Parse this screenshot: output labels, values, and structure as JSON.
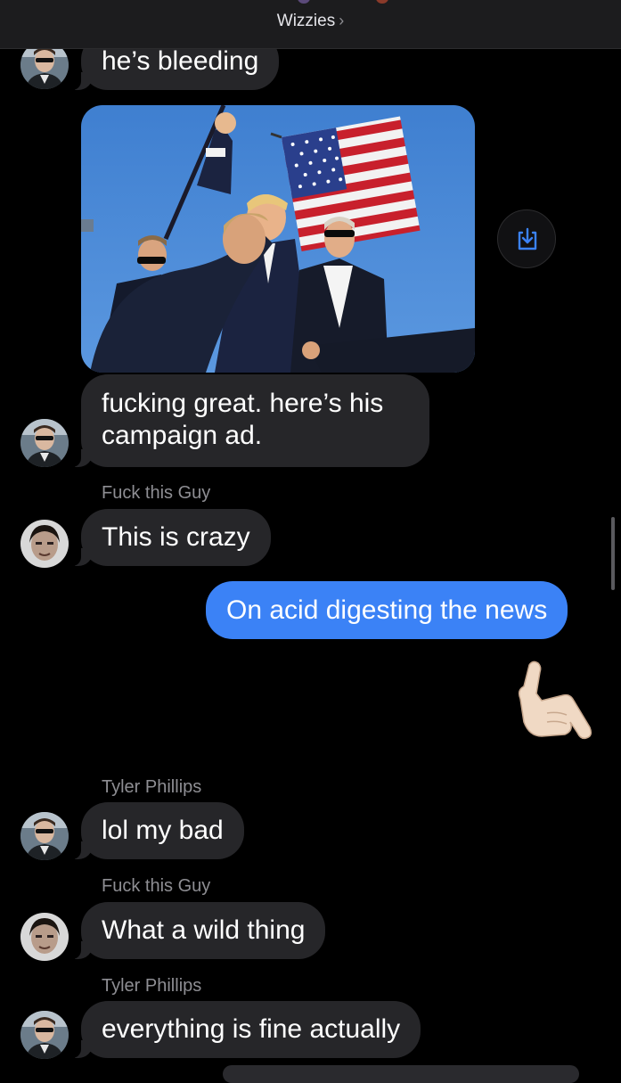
{
  "header": {
    "title": "Wizzies",
    "chevron": "›"
  },
  "messages": {
    "m1": {
      "text": "he’s bleeding"
    },
    "m2": {
      "text": "fucking great. here’s his campaign ad."
    },
    "m3": {
      "sender": "Fuck this Guy",
      "text": "This is crazy"
    },
    "m4": {
      "text": "On acid digesting the news"
    },
    "m5": {
      "sender": "Tyler Phillips",
      "text": "lol my bad"
    },
    "m6": {
      "sender": "Fuck this Guy",
      "text": "What a wild thing"
    },
    "m7": {
      "sender": "Tyler Phillips",
      "text": "everything is fine actually"
    }
  },
  "icons": {
    "save": "download-icon",
    "emoji": "call-me-hand-emoji"
  },
  "colors": {
    "background": "#000000",
    "received_bubble": "#262629",
    "sent_bubble": "#3b82f6",
    "sender_name": "#8e8e93",
    "accent": "#3b82f6"
  }
}
